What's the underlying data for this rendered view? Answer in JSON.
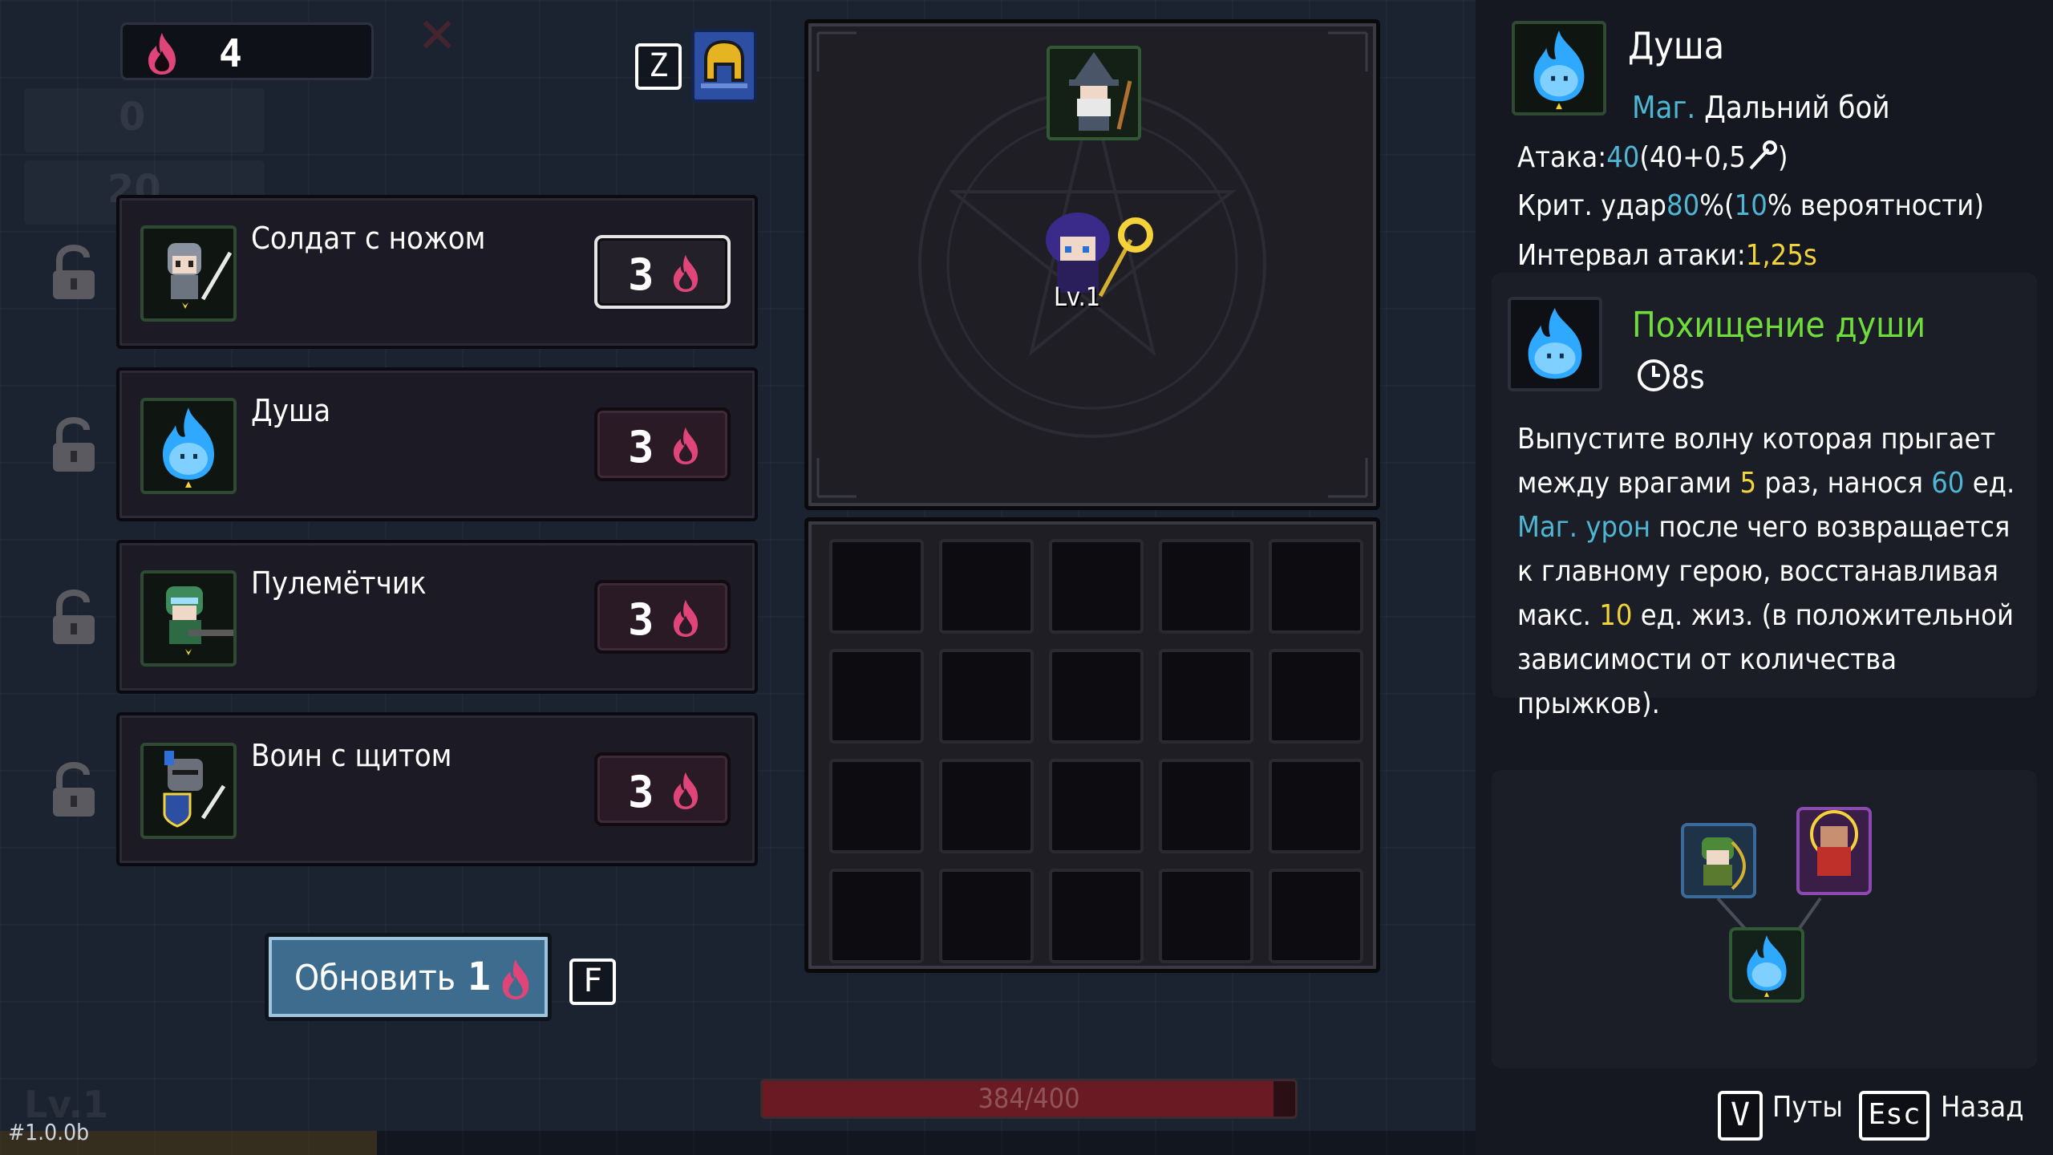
{
  "hud": {
    "soul_count": "4",
    "version": "#1.0.0b",
    "hp_text": "384/400",
    "hp_fraction": 0.96,
    "bg_level": "Lv.1",
    "bg_gem": "0",
    "bg_coin": "20"
  },
  "keys": {
    "pack_key": "Z",
    "refresh_key": "F",
    "paths_key": "V",
    "back_key": "Esc"
  },
  "shop": {
    "items": [
      {
        "name": "Солдат с ножом",
        "price": "3",
        "selected": true,
        "icon": "knife-soldier-portrait"
      },
      {
        "name": "Душа",
        "price": "3",
        "selected": false,
        "icon": "soul-portrait"
      },
      {
        "name": "Пулемётчик",
        "price": "3",
        "selected": false,
        "icon": "gunner-portrait"
      },
      {
        "name": "Воин с щитом",
        "price": "3",
        "selected": false,
        "icon": "shield-warrior-portrait"
      }
    ],
    "refresh_label": "Обновить",
    "refresh_price": "1"
  },
  "formation": {
    "main_level": "Lv.1"
  },
  "info": {
    "name": "Душа",
    "class_type": "Маг.",
    "class_range": "Дальний бой",
    "attack_label": "Атака:",
    "attack_value": "40",
    "attack_formula": "(40+0,5",
    "attack_close": ")",
    "crit_label": "Крит. удар",
    "crit_value": "80",
    "crit_pct_open": "%(",
    "crit_chance": "10",
    "crit_tail": "% вероятности)",
    "interval_label": "Интервал атаки:",
    "interval_value": "1,25s"
  },
  "skill": {
    "name": "Похищение души",
    "cooldown": "8s",
    "desc": {
      "p1": "Выпустите волну которая прыгает между врагами ",
      "jumps": "5",
      "p2": " раз, нанося ",
      "damage": "60",
      "p3": " ед. ",
      "dmg_type": "Маг. урон",
      "p4": " после чего возвращается к главному герою, восстанавливая макс. ",
      "heal": "10",
      "p5": " ед. жиз. (в положительной зависимости от количества прыжков)."
    }
  },
  "footer": {
    "paths_label": "Путы",
    "back_label": "Назад"
  },
  "colors": {
    "cyan": "#4eb6d3",
    "yellow": "#f1d33a",
    "green": "#6fdc3c",
    "soul_pink": "#e0457a",
    "soul_blue": "#2fa8ff"
  }
}
